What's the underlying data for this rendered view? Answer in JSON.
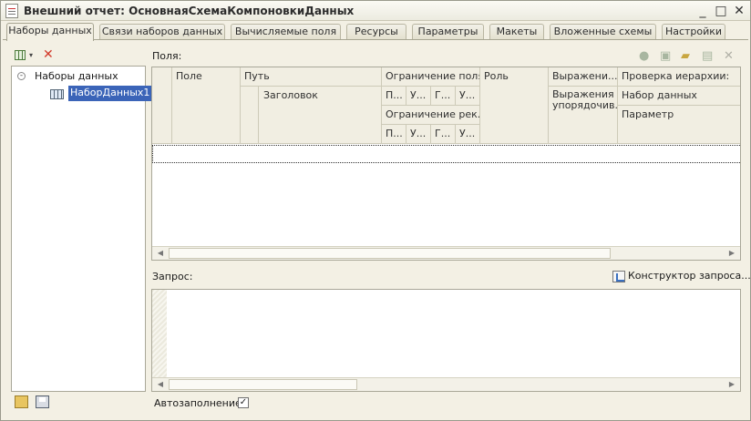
{
  "window": {
    "title": "Внешний отчет: ОсновнаяСхемаКомпоновкиДанных",
    "minimize": "_",
    "maximize": "□",
    "close": "✕"
  },
  "tabs": [
    {
      "label": "Наборы данных",
      "active": true
    },
    {
      "label": "Связи наборов данных"
    },
    {
      "label": "Вычисляемые поля"
    },
    {
      "label": "Ресурсы"
    },
    {
      "label": "Параметры"
    },
    {
      "label": "Макеты"
    },
    {
      "label": "Вложенные схемы"
    },
    {
      "label": "Настройки"
    }
  ],
  "tree": {
    "root_label": "Наборы данных",
    "items": [
      {
        "label": "НаборДанных1",
        "selected": true
      }
    ]
  },
  "fields": {
    "label": "Поля:",
    "columns": {
      "field": "Поле",
      "path": "Путь",
      "title": "Заголовок",
      "field_restriction": "Ограничение поля",
      "attr_restriction": "Ограничение рек...",
      "restriction_short": [
        "П...",
        "У...",
        "Г...",
        "У..."
      ],
      "role": "Роль",
      "expression": "Выражени...",
      "order_expression": "Выражения упорядочив...",
      "hierarchy_check": "Проверка иерархии:",
      "dataset": "Набор данных",
      "parameter": "Параметр"
    }
  },
  "query": {
    "label": "Запрос:",
    "builder_label": "Конструктор запроса...",
    "text": ""
  },
  "autofill": {
    "label": "Автозаполнение",
    "checked": true,
    "mark": "✓"
  },
  "colors": {
    "window_bg": "#f3f0e4",
    "selection": "#3b64b8",
    "delete_red": "#d23a2a"
  }
}
